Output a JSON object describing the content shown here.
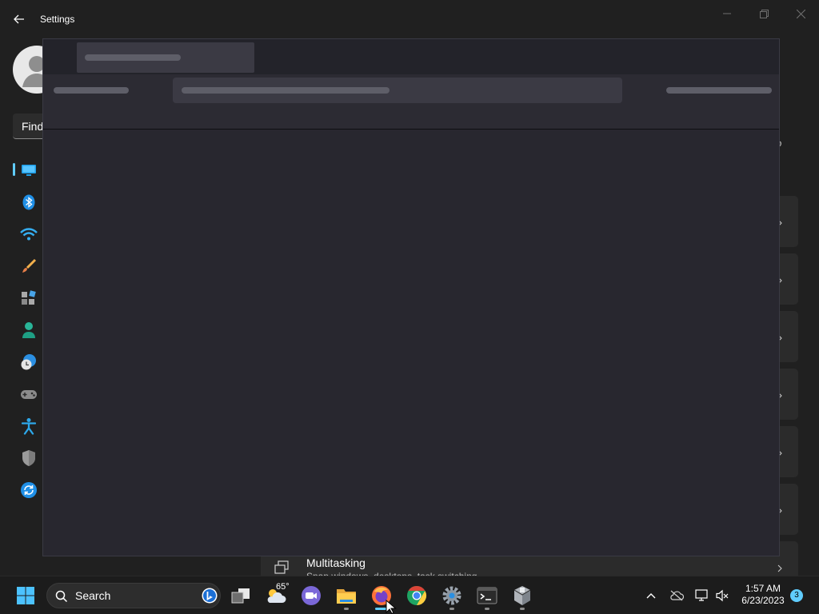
{
  "window": {
    "title": "Settings"
  },
  "sidebar": {
    "search_text": "Find",
    "items": [
      {
        "icon": "monitor-icon",
        "selected": true
      },
      {
        "icon": "bluetooth-icon"
      },
      {
        "icon": "wifi-icon"
      },
      {
        "icon": "brush-icon"
      },
      {
        "icon": "apps-icon"
      },
      {
        "icon": "person-icon"
      },
      {
        "icon": "time-language-icon"
      },
      {
        "icon": "gamepad-icon"
      },
      {
        "icon": "accessibility-icon"
      },
      {
        "icon": "shield-icon"
      },
      {
        "icon": "update-icon"
      }
    ]
  },
  "main": {
    "partial_text": "go",
    "multitasking": {
      "title": "Multitasking",
      "description": "Snap windows, desktops, task switching"
    }
  },
  "taskbar": {
    "search_label": "Search",
    "weather_temp": "65°",
    "clock_time": "1:57 AM",
    "clock_date": "6/23/2023",
    "notification_count": "3"
  },
  "colors": {
    "accent": "#60cdff",
    "background": "#202020",
    "taskbar": "#1c1c1c"
  }
}
